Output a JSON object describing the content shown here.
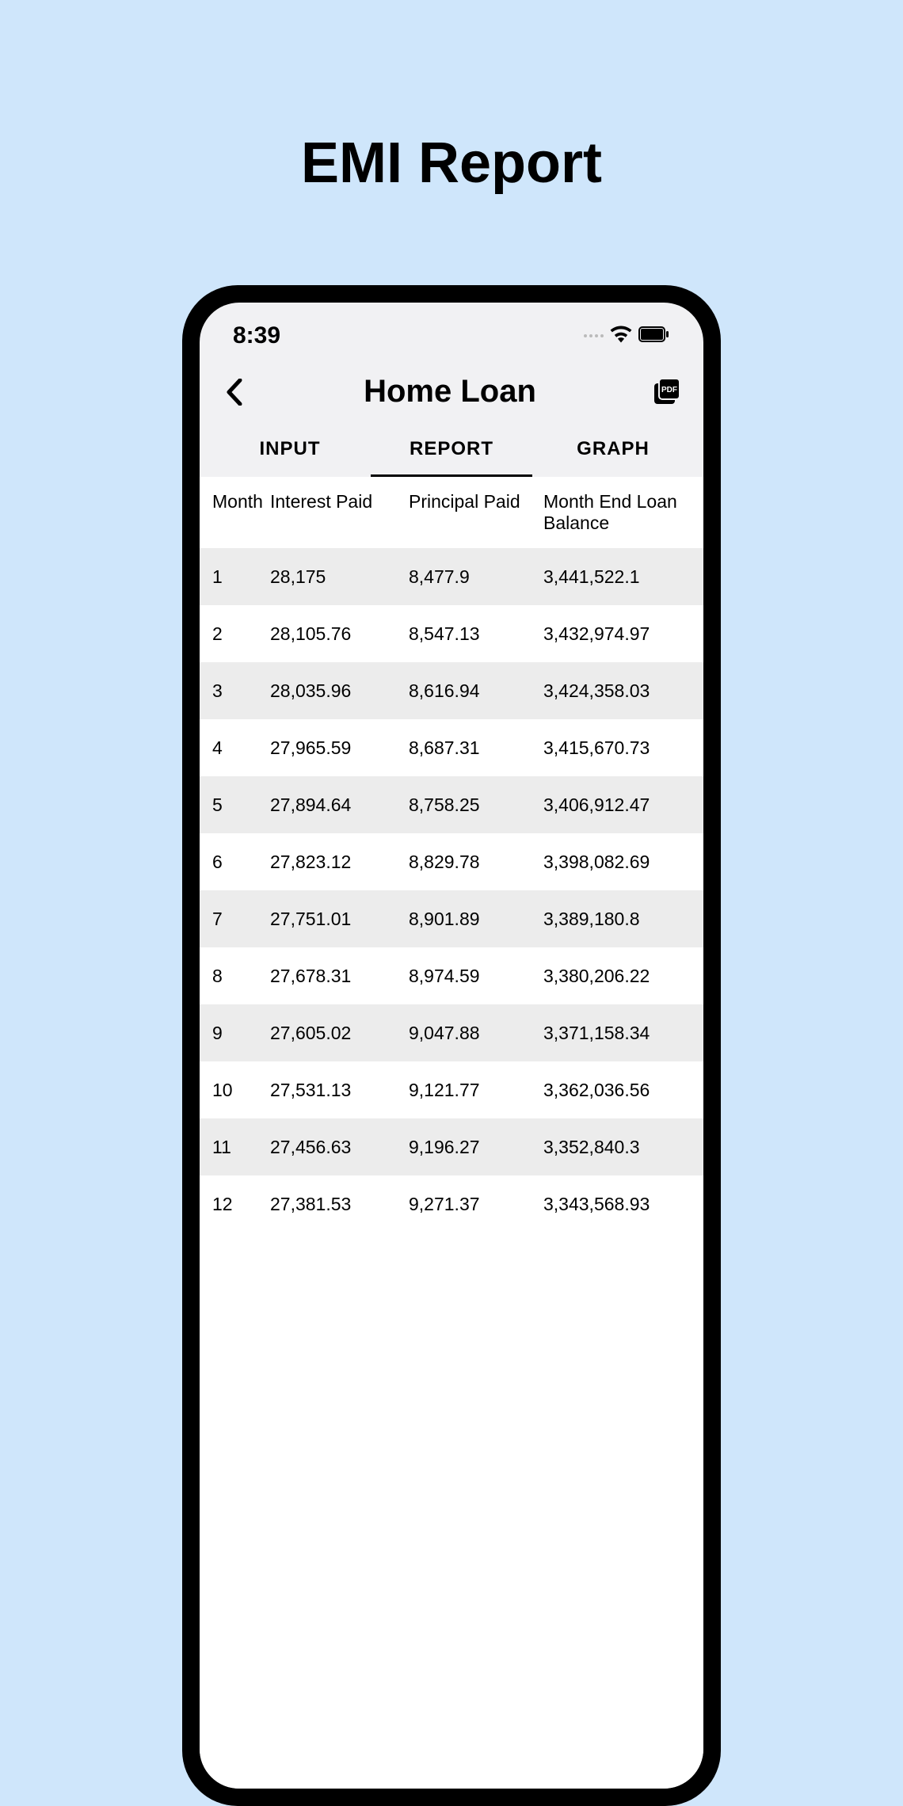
{
  "page": {
    "title": "EMI Report"
  },
  "status_bar": {
    "time": "8:39"
  },
  "header": {
    "title": "Home Loan"
  },
  "tabs": [
    {
      "label": "INPUT",
      "active": false
    },
    {
      "label": "REPORT",
      "active": true
    },
    {
      "label": "GRAPH",
      "active": false
    }
  ],
  "table": {
    "headers": {
      "month": "Month",
      "interest": "Interest Paid",
      "principal": "Principal Paid",
      "balance": "Month End Loan Balance"
    },
    "rows": [
      {
        "month": "1",
        "interest": "28,175",
        "principal": "8,477.9",
        "balance": "3,441,522.1"
      },
      {
        "month": "2",
        "interest": "28,105.76",
        "principal": "8,547.13",
        "balance": "3,432,974.97"
      },
      {
        "month": "3",
        "interest": "28,035.96",
        "principal": "8,616.94",
        "balance": "3,424,358.03"
      },
      {
        "month": "4",
        "interest": "27,965.59",
        "principal": "8,687.31",
        "balance": "3,415,670.73"
      },
      {
        "month": "5",
        "interest": "27,894.64",
        "principal": "8,758.25",
        "balance": "3,406,912.47"
      },
      {
        "month": "6",
        "interest": "27,823.12",
        "principal": "8,829.78",
        "balance": "3,398,082.69"
      },
      {
        "month": "7",
        "interest": "27,751.01",
        "principal": "8,901.89",
        "balance": "3,389,180.8"
      },
      {
        "month": "8",
        "interest": "27,678.31",
        "principal": "8,974.59",
        "balance": "3,380,206.22"
      },
      {
        "month": "9",
        "interest": "27,605.02",
        "principal": "9,047.88",
        "balance": "3,371,158.34"
      },
      {
        "month": "10",
        "interest": "27,531.13",
        "principal": "9,121.77",
        "balance": "3,362,036.56"
      },
      {
        "month": "11",
        "interest": "27,456.63",
        "principal": "9,196.27",
        "balance": "3,352,840.3"
      },
      {
        "month": "12",
        "interest": "27,381.53",
        "principal": "9,271.37",
        "balance": "3,343,568.93"
      }
    ]
  }
}
